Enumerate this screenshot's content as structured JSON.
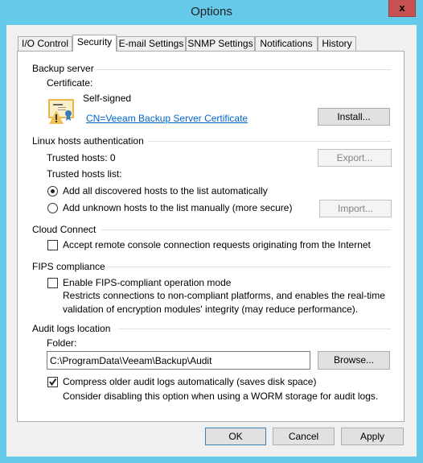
{
  "window": {
    "title": "Options",
    "close": "x"
  },
  "tabs": [
    {
      "label": "I/O Control"
    },
    {
      "label": "Security"
    },
    {
      "label": "E-mail Settings"
    },
    {
      "label": "SNMP Settings"
    },
    {
      "label": "Notifications"
    },
    {
      "label": "History"
    }
  ],
  "active_tab": "Security",
  "backup_server": {
    "heading": "Backup server",
    "certificate_label": "Certificate:",
    "certificate_status": "Self-signed",
    "certificate_link": "CN=Veeam Backup Server Certificate",
    "install": "Install...",
    "icon": "certificate-warning-icon"
  },
  "linux": {
    "heading": "Linux hosts authentication",
    "trusted_hosts": "Trusted hosts: 0",
    "export": "Export...",
    "list_label": "Trusted hosts list:",
    "option_auto": "Add all discovered hosts to the list automatically",
    "option_manual": "Add unknown hosts to the list manually (more secure)",
    "import": "Import...",
    "selected": "option_auto"
  },
  "cloud": {
    "heading": "Cloud Connect",
    "accept": "Accept remote console connection requests originating from the Internet",
    "accept_checked": false
  },
  "fips": {
    "heading": "FIPS compliance",
    "enable": "Enable FIPS-compliant operation mode",
    "enable_checked": false,
    "desc1": "Restricts connections to non-compliant platforms, and enables the real-time",
    "desc2": "validation of encryption modules' integrity (may reduce performance)."
  },
  "audit": {
    "heading": "Audit logs location",
    "folder_label": "Folder:",
    "folder_value": "C:\\ProgramData\\Veeam\\Backup\\Audit",
    "browse": "Browse...",
    "compress": "Compress older audit logs automatically (saves disk space)",
    "compress_checked": true,
    "compress_note": "Consider disabling this option when using a WORM storage for audit logs."
  },
  "footer": {
    "ok": "OK",
    "cancel": "Cancel",
    "apply": "Apply"
  },
  "colors": {
    "titlebar": "#65c9e9",
    "close": "#c75050",
    "link": "#0066cc"
  }
}
